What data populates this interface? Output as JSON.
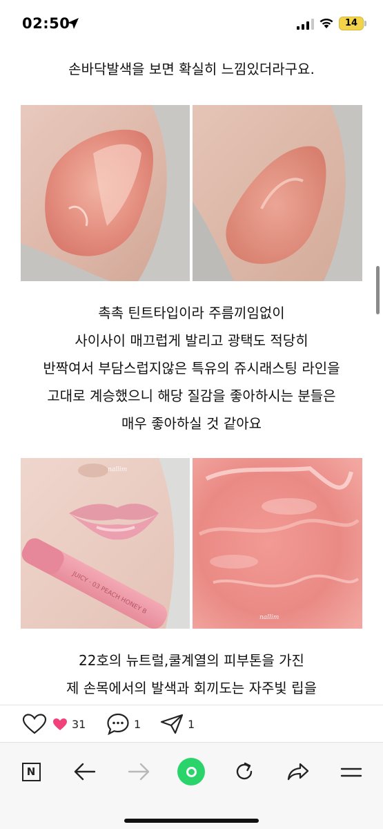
{
  "status_bar": {
    "time": "02:50",
    "battery": "14",
    "battery_color": "#f2d34a"
  },
  "article": {
    "paragraph1": [
      "손바닥발색을 보면 확실히 느낌있더라구요."
    ],
    "images_row1_alt": [
      "swatch-arm-left",
      "swatch-arm-right"
    ],
    "paragraph2": [
      "촉촉 틴트타입이라 주름끼임없이",
      "사이사이 매끄럽게 발리고 광택도 적당히",
      "반짝여서 부담스럽지않은 특유의 쥬시래스팅 라인을",
      "고대로 계승했으니 해당 질감을 좋아하시는 분들은",
      "매우 좋아하실 것 같아요"
    ],
    "watermark": "nallim",
    "tube_label": "JUICY · 03 PEACH HONEY B",
    "paragraph3": [
      "22호의 뉴트럴,쿨계열의 피부톤을 가진",
      "제 손목에서의 발색과 회끼도는 자주빛 립을"
    ]
  },
  "actions": {
    "like_count": "31",
    "comment_count": "1",
    "share_count": "1",
    "heart_color": "#f0417a"
  },
  "toolbar": {
    "n_label": "N",
    "accent": "#2bd46b",
    "icons": [
      "naver-n-icon",
      "back-arrow-icon",
      "forward-arrow-icon",
      "home-green-icon",
      "refresh-icon",
      "share-arrow-icon",
      "menu-icon"
    ]
  }
}
